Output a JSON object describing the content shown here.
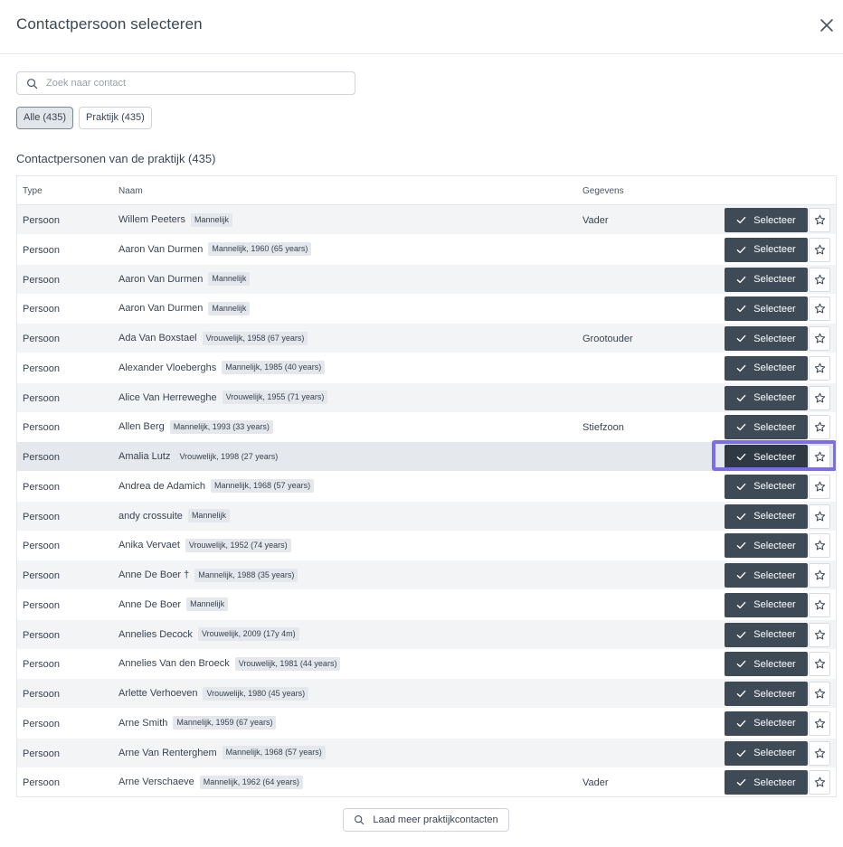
{
  "modal": {
    "title": "Contactpersoon selecteren",
    "close_icon": "close-icon"
  },
  "search": {
    "placeholder": "Zoek naar contact",
    "value": "",
    "icon": "search-icon"
  },
  "filters": [
    {
      "label": "Alle (435)",
      "active": true
    },
    {
      "label": "Praktijk (435)",
      "active": false
    }
  ],
  "section_title": "Contactpersonen van de praktijk (435)",
  "table": {
    "columns": {
      "type": "Type",
      "name": "Naam",
      "details": "Gegevens"
    },
    "select_label": "Selecteer",
    "select_icon": "check-icon",
    "favorite_icon": "star-icon",
    "rows": [
      {
        "type": "Persoon",
        "name": "Willem Peeters",
        "badge": "Mannelijk",
        "details": "Vader"
      },
      {
        "type": "Persoon",
        "name": "Aaron Van Durmen",
        "badge": "Mannelijk, 1960 (65 years)",
        "details": ""
      },
      {
        "type": "Persoon",
        "name": "Aaron Van Durmen",
        "badge": "Mannelijk",
        "details": ""
      },
      {
        "type": "Persoon",
        "name": "Aaron Van Durmen",
        "badge": "Mannelijk",
        "details": ""
      },
      {
        "type": "Persoon",
        "name": "Ada Van Boxstael",
        "badge": "Vrouwelijk, 1958 (67 years)",
        "details": "Grootouder"
      },
      {
        "type": "Persoon",
        "name": "Alexander Vloeberghs",
        "badge": "Mannelijk, 1985 (40 years)",
        "details": ""
      },
      {
        "type": "Persoon",
        "name": "Alice Van Herreweghe",
        "badge": "Vrouwelijk, 1955 (71 years)",
        "details": ""
      },
      {
        "type": "Persoon",
        "name": "Allen Berg",
        "badge": "Mannelijk, 1993 (33 years)",
        "details": "Stiefzoon"
      },
      {
        "type": "Persoon",
        "name": "Amalia Lutz",
        "badge": "Vrouwelijk, 1998 (27 years)",
        "details": "",
        "focused": true
      },
      {
        "type": "Persoon",
        "name": "Andrea de Adamich",
        "badge": "Mannelijk, 1968 (57 years)",
        "details": ""
      },
      {
        "type": "Persoon",
        "name": "andy crossuite",
        "badge": "Mannelijk",
        "details": ""
      },
      {
        "type": "Persoon",
        "name": "Anika Vervaet",
        "badge": "Vrouwelijk, 1952 (74 years)",
        "details": ""
      },
      {
        "type": "Persoon",
        "name": "Anne De Boer †",
        "badge": "Mannelijk, 1988 (35 years)",
        "details": ""
      },
      {
        "type": "Persoon",
        "name": "Anne De Boer",
        "badge": "Mannelijk",
        "details": ""
      },
      {
        "type": "Persoon",
        "name": "Annelies Decock",
        "badge": "Vrouwelijk, 2009 (17y 4m)",
        "details": ""
      },
      {
        "type": "Persoon",
        "name": "Annelies Van den Broeck",
        "badge": "Vrouwelijk, 1981 (44 years)",
        "details": ""
      },
      {
        "type": "Persoon",
        "name": "Arlette Verhoeven",
        "badge": "Vrouwelijk, 1980 (45 years)",
        "details": ""
      },
      {
        "type": "Persoon",
        "name": "Arne Smith",
        "badge": "Mannelijk, 1959 (67 years)",
        "details": ""
      },
      {
        "type": "Persoon",
        "name": "Arne Van Renterghem",
        "badge": "Mannelijk, 1968 (57 years)",
        "details": ""
      },
      {
        "type": "Persoon",
        "name": "Arne Verschaeve",
        "badge": "Mannelijk, 1962 (64 years)",
        "details": "Vader"
      }
    ]
  },
  "load_more": {
    "label": "Laad meer praktijkcontacten",
    "icon": "search-icon"
  },
  "colors": {
    "primary_button": "#3e4b57",
    "focus_ring": "#7b6cf0",
    "zebra": "#f3f4f6"
  }
}
